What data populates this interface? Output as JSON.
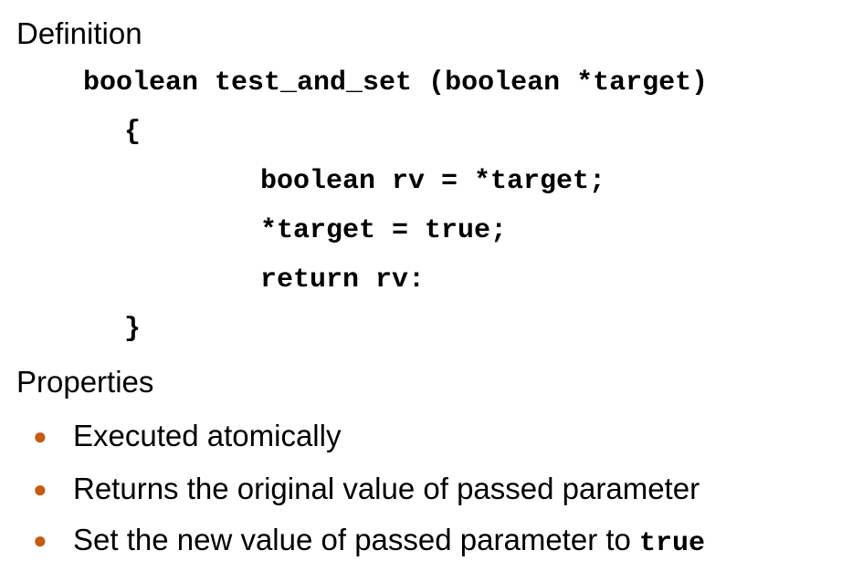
{
  "definition": {
    "heading": "Definition",
    "code_lines": [
      "boolean test_and_set (boolean *target)",
      "{",
      "boolean rv = *target;",
      "*target = true;",
      "return rv:",
      "}"
    ]
  },
  "properties": {
    "heading": "Properties",
    "bullet_color": "#c55a11",
    "items": [
      {
        "text": "Executed atomically"
      },
      {
        "text": "Returns the original value of passed parameter"
      },
      {
        "text": "Set the new value of passed parameter to ",
        "code": "true"
      }
    ]
  }
}
